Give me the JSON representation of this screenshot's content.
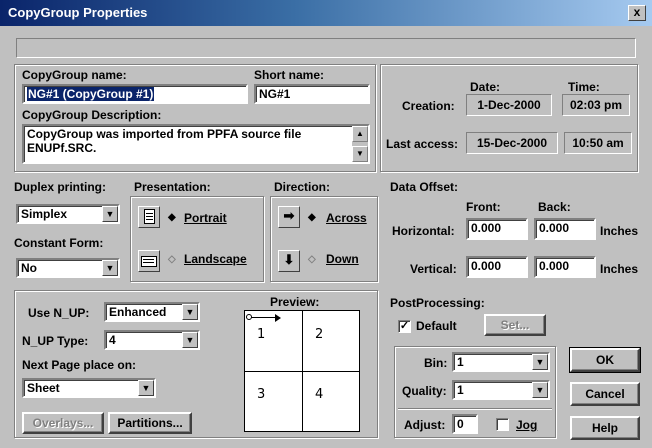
{
  "window": {
    "title": "CopyGroup Properties",
    "close_glyph": "x"
  },
  "identity": {
    "name_label": "CopyGroup name:",
    "name_value": "NG#1 (CopyGroup #1)",
    "short_label": "Short name:",
    "short_value": "NG#1",
    "desc_label": "CopyGroup Description:",
    "desc_value": "CopyGroup was imported from PPFA source file ENUPf.SRC."
  },
  "dates": {
    "date_header": "Date:",
    "time_header": "Time:",
    "creation_label": "Creation:",
    "creation_date": "1-Dec-2000",
    "creation_time": "02:03 pm",
    "access_label": "Last access:",
    "access_date": "15-Dec-2000",
    "access_time": "10:50 am"
  },
  "duplex": {
    "label": "Duplex printing:",
    "value": "Simplex"
  },
  "constant_form": {
    "label": "Constant Form:",
    "value": "No"
  },
  "presentation": {
    "label": "Presentation:",
    "portrait": "Portrait",
    "landscape": "Landscape",
    "selected": "Portrait"
  },
  "direction": {
    "label": "Direction:",
    "across": "Across",
    "down": "Down",
    "selected": "Across"
  },
  "data_offset": {
    "label": "Data Offset:",
    "front_label": "Front:",
    "back_label": "Back:",
    "horizontal_label": "Horizontal:",
    "vertical_label": "Vertical:",
    "h_front": "0.000",
    "h_back": "0.000",
    "v_front": "0.000",
    "v_back": "0.000",
    "unit": "Inches"
  },
  "nup": {
    "use_label": "Use N_UP:",
    "use_value": "Enhanced",
    "type_label": "N_UP Type:",
    "type_value": "4",
    "next_label": "Next Page place on:",
    "next_value": "Sheet",
    "overlays_button": "Overlays...",
    "partitions_button": "Partitions..."
  },
  "preview": {
    "label": "Preview:",
    "cells": [
      "1",
      "2",
      "3",
      "4"
    ]
  },
  "postprocessing": {
    "label": "PostProcessing:",
    "default_label": "Default",
    "default_checked": true,
    "set_button": "Set..."
  },
  "bin": {
    "label": "Bin:",
    "value": "1"
  },
  "quality": {
    "label": "Quality:",
    "value": "1"
  },
  "adjust": {
    "label": "Adjust:",
    "value": "0"
  },
  "jog": {
    "label": "Jog",
    "checked": false
  },
  "buttons": {
    "ok": "OK",
    "cancel": "Cancel",
    "help": "Help"
  },
  "symbols": {
    "dropdown_arrow": "▼",
    "scroll_up": "▲",
    "scroll_down": "▼",
    "radio_selected": "◆",
    "radio_unselected": "◇",
    "check": "✓"
  }
}
